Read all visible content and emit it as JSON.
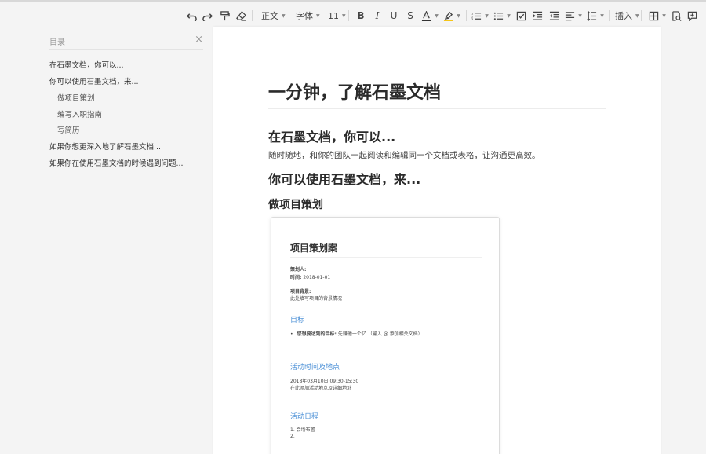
{
  "toolbar": {
    "style_label": "正文",
    "font_label": "字体",
    "size_label": "11",
    "insert_label": "插入"
  },
  "outline": {
    "title": "目录",
    "close": "×",
    "items": [
      "在石墨文档，你可以...",
      "你可以使用石墨文档，来...",
      "做项目策划",
      "编写入职指南",
      "写简历",
      "如果你想更深入地了解石墨文档...",
      "如果你在使用石墨文档的时候遇到问题..."
    ]
  },
  "document": {
    "title": "一分钟，了解石墨文档",
    "section1_heading": "在石墨文档，你可以...",
    "section1_text": "随时随地，和你的团队一起阅读和编辑同一个文档或表格，让沟通更高效。",
    "section2_heading": "你可以使用石墨文档，来...",
    "section3_heading": "做项目策划"
  },
  "card": {
    "title": "项目策划案",
    "planner_label": "策划人:",
    "time_label": "时间:",
    "time_value": "2018-01-01",
    "background_label": "项目背景:",
    "background_text": "此处填写项目的背景情况",
    "goal_heading": "目标",
    "goal_label": "您想要达到的目标:",
    "goal_text": "先赚他一个亿 （输入 @ 添加相关文档）",
    "venue_heading": "活动时间及地点",
    "venue_date": "2018年03月10日  09:30-15:30",
    "venue_text": "在此添加活动地点及详细地址",
    "schedule_heading": "活动日程",
    "schedule_1": "1.  会场布置",
    "schedule_2": "2."
  },
  "colors": {
    "accent_link": "#4a8fd6",
    "font_color_underline": "#333333",
    "highlight_underline": "#f5c518"
  }
}
